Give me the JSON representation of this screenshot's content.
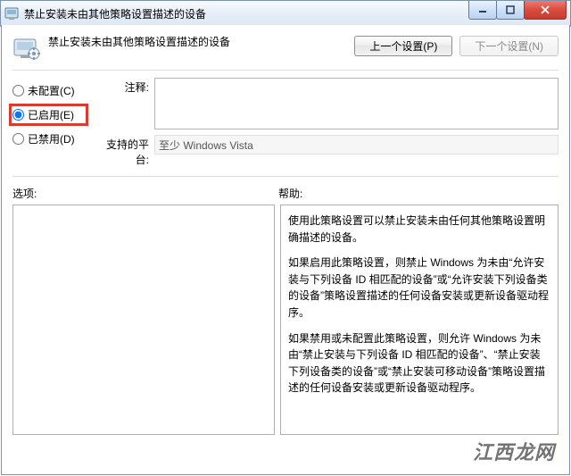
{
  "window": {
    "title": "禁止安装未由其他策略设置描述的设备"
  },
  "header": {
    "policy_title": "禁止安装未由其他策略设置描述的设备",
    "prev_button": "上一个设置(P)",
    "next_button": "下一个设置(N)"
  },
  "state": {
    "not_configured": "未配置(C)",
    "enabled": "已启用(E)",
    "disabled": "已禁用(D)"
  },
  "fields": {
    "comment_label": "注释:",
    "comment_value": "",
    "platform_label": "支持的平台:",
    "platform_value": "至少 Windows Vista"
  },
  "sections": {
    "options_label": "选项:",
    "help_label": "帮助:"
  },
  "help": {
    "p1": "使用此策略设置可以禁止安装未由任何其他策略设置明确描述的设备。",
    "p2": "如果启用此策略设置，则禁止 Windows 为未由“允许安装与下列设备 ID 相匹配的设备”或“允许安装下列设备类的设备”策略设置描述的任何设备安装或更新设备驱动程序。",
    "p3": "如果禁用或未配置此策略设置，则允许 Windows 为未由“禁止安装与下列设备 ID 相匹配的设备”、“禁止安装下列设备类的设备”或“禁止安装可移动设备”策略设置描述的任何设备安装或更新设备驱动程序。"
  },
  "watermark": "江西龙网"
}
